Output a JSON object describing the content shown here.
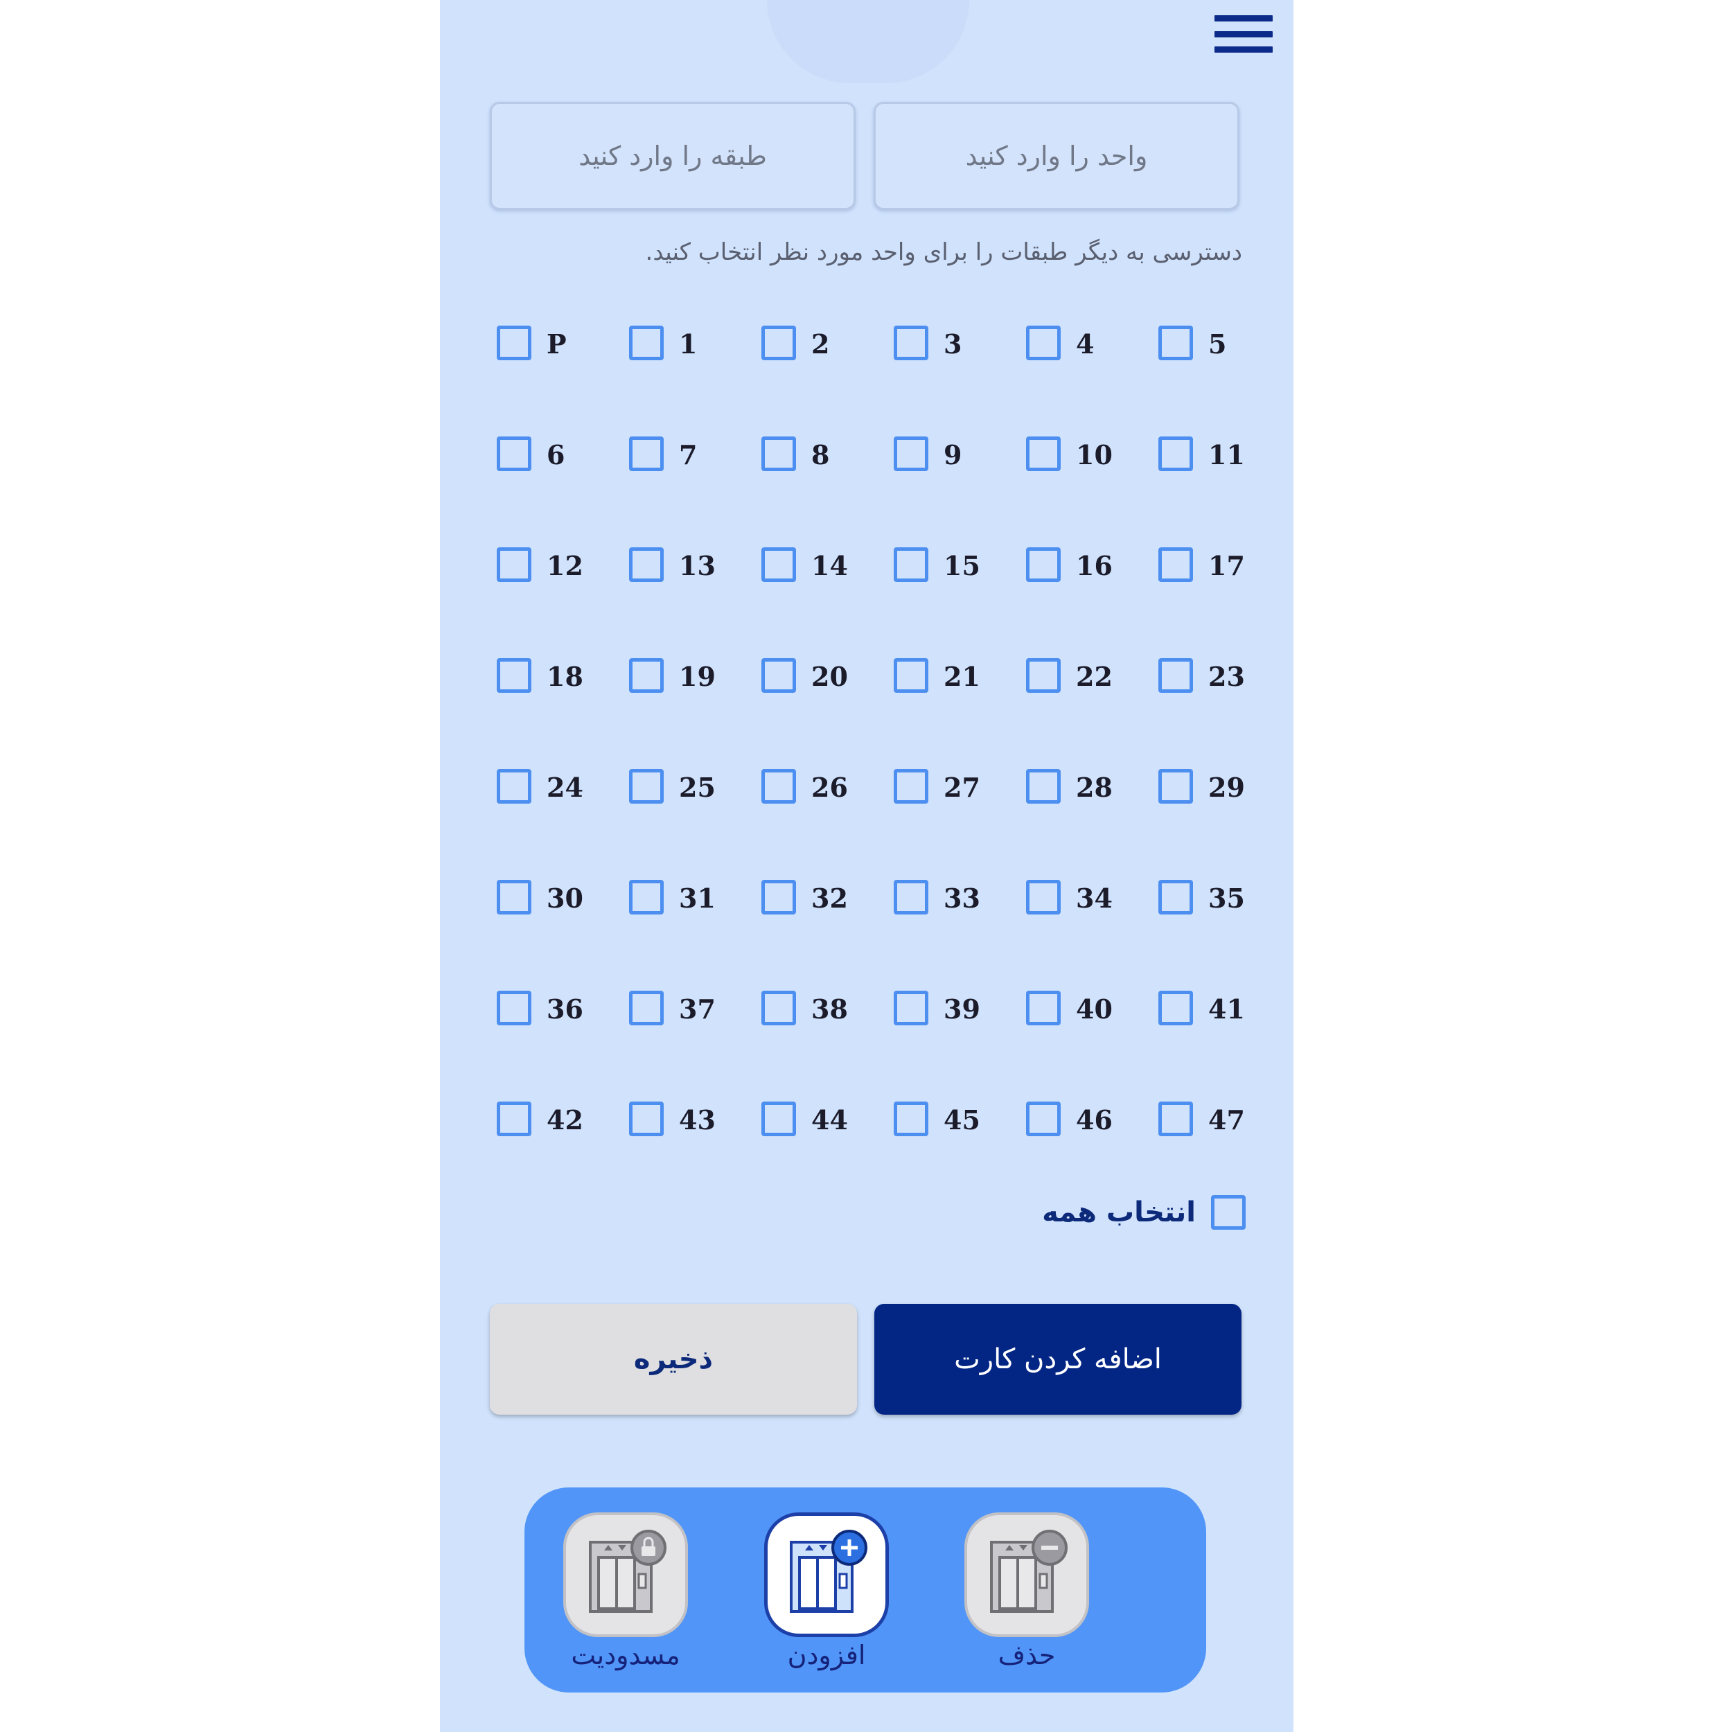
{
  "inputs": {
    "unit_placeholder": "واحد را وارد کنید",
    "floor_placeholder": "طبقه را وارد کنید"
  },
  "hint": "دسترسی به دیگر طبقات را برای واحد مورد نظر انتخاب کنید.",
  "floors": [
    "P",
    "1",
    "2",
    "3",
    "4",
    "5",
    "6",
    "7",
    "8",
    "9",
    "10",
    "11",
    "12",
    "13",
    "14",
    "15",
    "16",
    "17",
    "18",
    "19",
    "20",
    "21",
    "22",
    "23",
    "24",
    "25",
    "26",
    "27",
    "28",
    "29",
    "30",
    "31",
    "32",
    "33",
    "34",
    "35",
    "36",
    "37",
    "38",
    "39",
    "40",
    "41",
    "42",
    "43",
    "44",
    "45",
    "46",
    "47"
  ],
  "select_all": "انتخاب همه",
  "buttons": {
    "add_card": "اضافه کردن کارت",
    "save": "ذخیره"
  },
  "nav": {
    "block": "مسدودیت",
    "add": "افزودن",
    "delete": "حذف",
    "active": "add"
  },
  "colors": {
    "background": "#d0e2fc",
    "accent_dark": "#032685",
    "checkbox": "#4d8ff0",
    "nav_bar": "#5095f7"
  },
  "icons": {
    "menu": "hamburger-menu-icon",
    "block": "elevator-lock-icon",
    "add": "elevator-plus-icon",
    "delete": "elevator-minus-icon"
  }
}
